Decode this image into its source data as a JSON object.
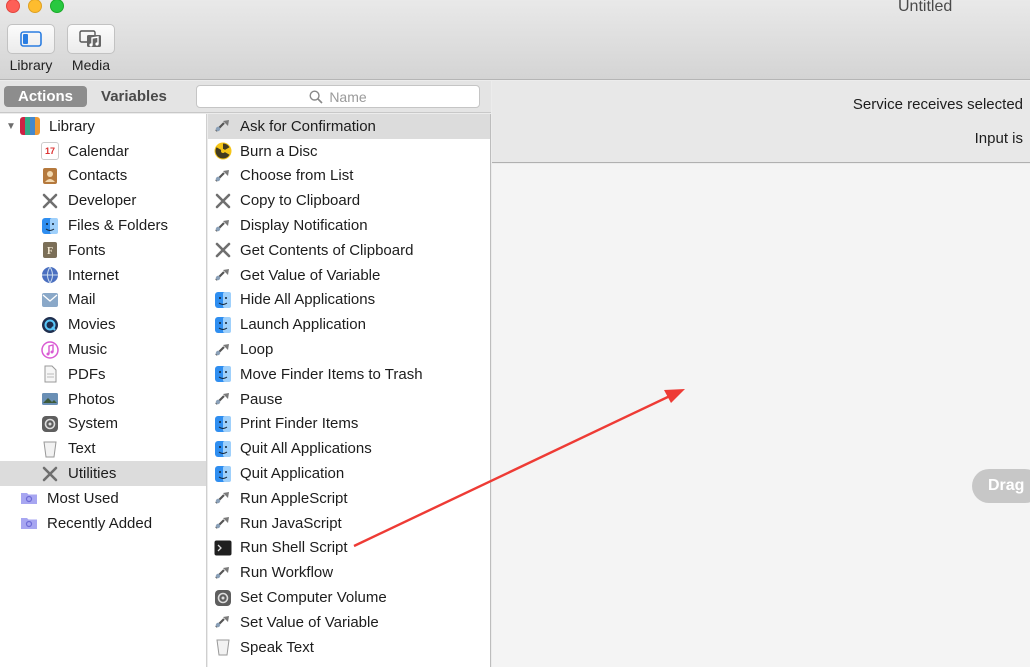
{
  "window": {
    "title": "Untitled"
  },
  "colors": {
    "close": "#fe5f57",
    "minimize": "#febc2e",
    "zoom": "#28c840",
    "annotation": "#ee3b35"
  },
  "toolbar": {
    "library_label": "Library",
    "media_label": "Media"
  },
  "tabs": {
    "actions": "Actions",
    "variables": "Variables"
  },
  "search": {
    "placeholder": "Name"
  },
  "library": {
    "root": "Library",
    "items": [
      {
        "label": "Calendar",
        "icon": "calendar-icon",
        "color": "#ffffff"
      },
      {
        "label": "Contacts",
        "icon": "contacts-icon",
        "color": "#b5793d"
      },
      {
        "label": "Developer",
        "icon": "tools-icon",
        "color": "#7c7c7c"
      },
      {
        "label": "Files & Folders",
        "icon": "finder-icon",
        "color": "#2f8ef0"
      },
      {
        "label": "Fonts",
        "icon": "fonts-icon",
        "color": "#8a7d63"
      },
      {
        "label": "Internet",
        "icon": "globe-icon",
        "color": "#4467b5"
      },
      {
        "label": "Mail",
        "icon": "mail-icon",
        "color": "#6f8fb0"
      },
      {
        "label": "Movies",
        "icon": "quicktime-icon",
        "color": "#1f2f4f"
      },
      {
        "label": "Music",
        "icon": "music-icon",
        "color": "#d95ad3"
      },
      {
        "label": "PDFs",
        "icon": "pdf-icon",
        "color": "#d9d9d9"
      },
      {
        "label": "Photos",
        "icon": "photos-icon",
        "color": "#6a8fb5"
      },
      {
        "label": "System",
        "icon": "system-icon",
        "color": "#555555"
      },
      {
        "label": "Text",
        "icon": "text-icon",
        "color": "#e8e8e8"
      },
      {
        "label": "Utilities",
        "icon": "utilities-icon",
        "color": "#7c7c7c"
      }
    ],
    "extra": [
      {
        "label": "Most Used",
        "icon": "smart-folder-icon",
        "color": "#a7a6f1"
      },
      {
        "label": "Recently Added",
        "icon": "smart-folder-icon",
        "color": "#a7a6f1"
      }
    ]
  },
  "actions": [
    {
      "label": "Ask for Confirmation",
      "icon": "automator-icon"
    },
    {
      "label": "Burn a Disc",
      "icon": "radiation-icon"
    },
    {
      "label": "Choose from List",
      "icon": "automator-icon"
    },
    {
      "label": "Copy to Clipboard",
      "icon": "tools-icon"
    },
    {
      "label": "Display Notification",
      "icon": "automator-icon"
    },
    {
      "label": "Get Contents of Clipboard",
      "icon": "tools-icon"
    },
    {
      "label": "Get Value of Variable",
      "icon": "automator-icon"
    },
    {
      "label": "Hide All Applications",
      "icon": "finder-icon"
    },
    {
      "label": "Launch Application",
      "icon": "finder-icon"
    },
    {
      "label": "Loop",
      "icon": "automator-icon"
    },
    {
      "label": "Move Finder Items to Trash",
      "icon": "finder-icon"
    },
    {
      "label": "Pause",
      "icon": "automator-icon"
    },
    {
      "label": "Print Finder Items",
      "icon": "finder-icon"
    },
    {
      "label": "Quit All Applications",
      "icon": "finder-icon"
    },
    {
      "label": "Quit Application",
      "icon": "finder-icon"
    },
    {
      "label": "Run AppleScript",
      "icon": "automator-icon"
    },
    {
      "label": "Run JavaScript",
      "icon": "automator-icon"
    },
    {
      "label": "Run Shell Script",
      "icon": "terminal-icon"
    },
    {
      "label": "Run Workflow",
      "icon": "automator-icon"
    },
    {
      "label": "Set Computer Volume",
      "icon": "system-icon"
    },
    {
      "label": "Set Value of Variable",
      "icon": "automator-icon"
    },
    {
      "label": "Speak Text",
      "icon": "text-icon"
    }
  ],
  "workflow": {
    "receives_label": "Service receives selected",
    "input_label": "Input is",
    "drag_hint": "Drag"
  }
}
